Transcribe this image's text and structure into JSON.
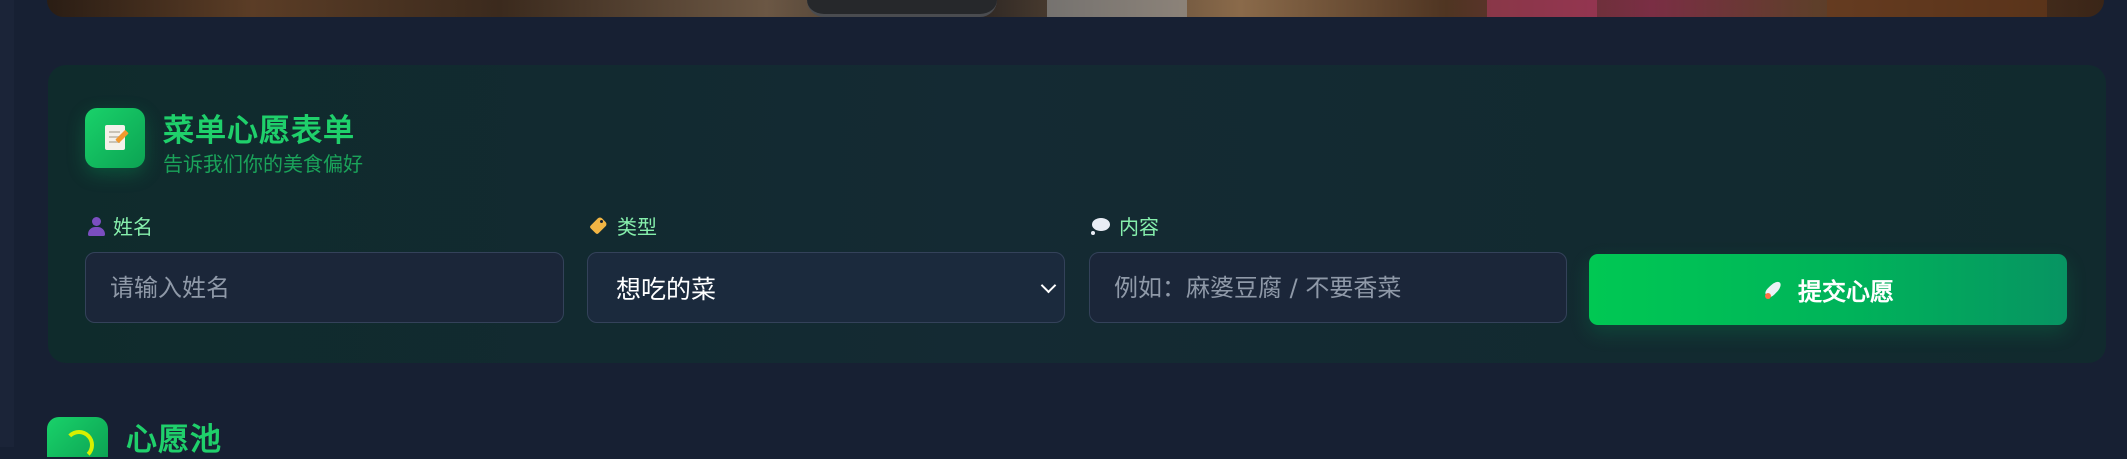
{
  "form": {
    "title": "菜单心愿表单",
    "subtitle": "告诉我们你的美食偏好",
    "icon": "memo-icon",
    "fields": {
      "name": {
        "label": "姓名",
        "icon": "person-icon",
        "value": "",
        "placeholder": "请输入姓名"
      },
      "type": {
        "label": "类型",
        "icon": "tag-icon",
        "selected": "想吃的菜"
      },
      "content": {
        "label": "内容",
        "icon": "speech-bubble-icon",
        "value": "",
        "placeholder": "例如：麻婆豆腐 / 不要香菜"
      }
    },
    "submit": {
      "label": "提交心愿",
      "icon": "rocket-icon"
    }
  },
  "wish_pool": {
    "title": "心愿池",
    "icon": "pool-icon"
  },
  "colors": {
    "page_background": "#172033",
    "accent_green": "#1fd06b",
    "label_green": "#86efac",
    "button_gradient_start": "#00c853",
    "button_gradient_end": "#079462"
  }
}
